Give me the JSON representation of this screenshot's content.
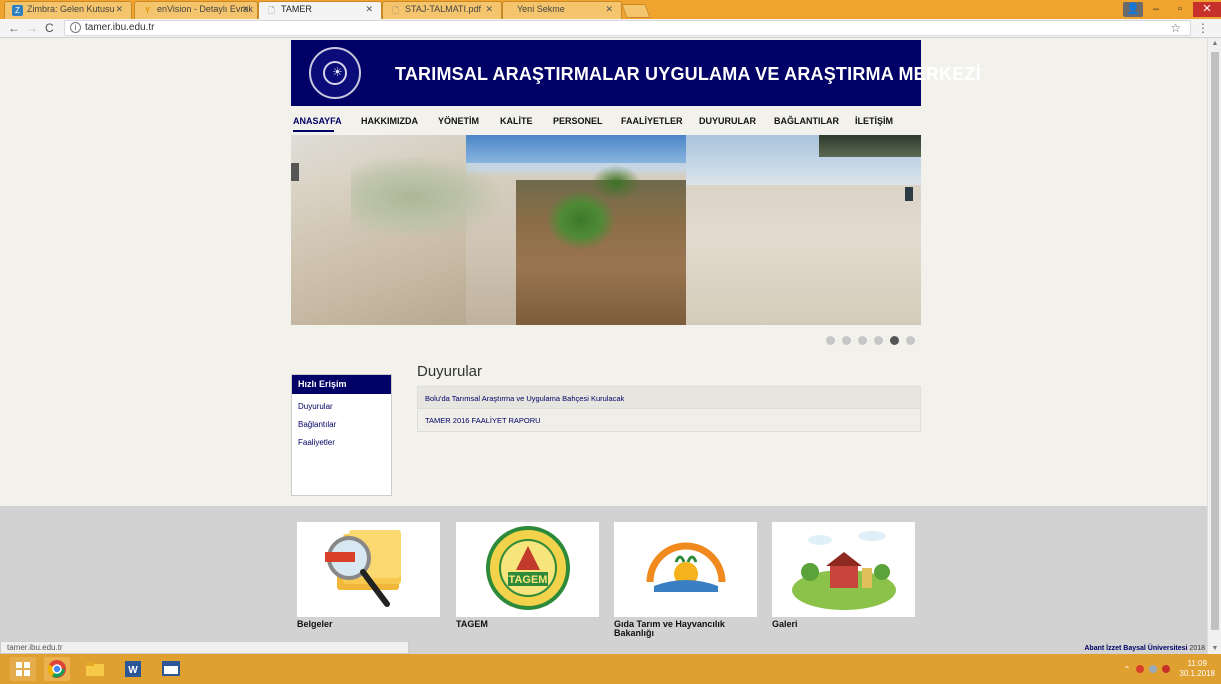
{
  "browser": {
    "tabs": [
      {
        "label": "Zimbra: Gelen Kutusu",
        "fav": "Z",
        "fav_color": "#2e7fbf",
        "active": false
      },
      {
        "label": "enVision - Detaylı Evrak",
        "fav": "Y",
        "fav_color": "#e2a000",
        "active": false
      },
      {
        "label": "TAMER",
        "fav": "page-icon",
        "fav_color": "#777777",
        "active": true
      },
      {
        "label": "STAJ-TALMATI.pdf",
        "fav": "page-icon",
        "fav_color": "#777777",
        "active": false
      },
      {
        "label": "Yeni Sekme",
        "fav": "",
        "fav_color": "#e8b866",
        "active": false
      }
    ],
    "address": "tamer.ibu.edu.tr",
    "status_url": "tamer.ibu.edu.tr"
  },
  "site": {
    "title": "TARIMSAL ARAŞTIRMALAR UYGULAMA VE ARAŞTIRMA MERKEZİ",
    "logo": "university-seal-icon",
    "nav": [
      "ANASAYFA",
      "HAKKIMIZDA",
      "YÖNETİM",
      "KALİTE",
      "PERSONEL",
      "FAALİYETLER",
      "DUYURULAR",
      "BAĞLANTILAR",
      "İLETİŞİM"
    ],
    "active_nav": "ANASAYFA",
    "slider": {
      "dots": 6,
      "active_dot": 5
    },
    "quick_access": {
      "title": "Hızlı Erişim",
      "items": [
        "Duyurular",
        "Bağlantılar",
        "Faaliyetler"
      ]
    },
    "announcements": {
      "title": "Duyurular",
      "items": [
        "Bolu'da Tarımsal Araştırma ve Uygulama Bahçesi Kurulacak",
        "TAMER 2016 FAALİYET RAPORU"
      ]
    },
    "cards": [
      {
        "label": "Belgeler",
        "image": "folders-magnifier-image"
      },
      {
        "label": "TAGEM",
        "image": "tagem-logo-image"
      },
      {
        "label": "Gıda Tarım ve Hayvancılık Bakanlığı",
        "image": "ministry-logo-image"
      },
      {
        "label": "Galeri",
        "image": "farm-illustration-image"
      }
    ],
    "copyright": {
      "name": "Abant İzzet Baysal Üniversitesi",
      "year": "2018"
    }
  },
  "taskbar": {
    "time": "11:09",
    "date": "30.1.2018"
  },
  "colors": {
    "brand": "#000066",
    "taskbar": "#e0a030",
    "tabstrip": "#f0a42f"
  }
}
